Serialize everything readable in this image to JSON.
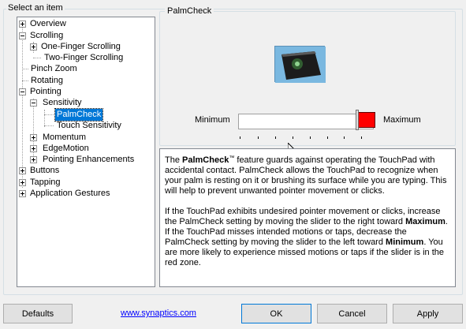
{
  "group_title": "Select an item",
  "tree": {
    "overview": "Overview",
    "scrolling": "Scrolling",
    "one_finger": "One-Finger Scrolling",
    "two_finger": "Two-Finger Scrolling",
    "pinch_zoom": "Pinch Zoom",
    "rotating": "Rotating",
    "pointing": "Pointing",
    "sensitivity": "Sensitivity",
    "palmcheck": "PalmCheck",
    "touch_sensitivity": "Touch Sensitivity",
    "momentum": "Momentum",
    "edgemotion": "EdgeMotion",
    "pointing_enhancements": "Pointing Enhancements",
    "buttons": "Buttons",
    "tapping": "Tapping",
    "app_gestures": "Application Gestures"
  },
  "panel": {
    "title": "PalmCheck",
    "min_label": "Minimum",
    "max_label": "Maximum",
    "slider_value_fraction": 0.87,
    "colors": {
      "red_zone": "#ff0000",
      "selection": "#0078d7"
    }
  },
  "description": {
    "p1_pre": "The ",
    "p1_bold": "PalmCheck",
    "p1_tm": "™",
    "p1_post": " feature guards against operating the TouchPad with accidental contact. PalmCheck allows the TouchPad to recognize when your palm is resting on it or brushing its surface while you are typing. This will help to prevent unwanted pointer movement or clicks.",
    "p2_a": "If the TouchPad exhibits undesired pointer movement or clicks, increase the PalmCheck setting by moving the slider to the right toward ",
    "p2_b": "Maximum",
    "p2_c": ". If the TouchPad misses intended motions or taps, decrease the PalmCheck setting by moving the slider to the left toward ",
    "p2_d": "Minimum",
    "p2_e": ". You are more likely to experience missed motions or taps if the slider is in the red zone."
  },
  "footer": {
    "defaults": "Defaults",
    "link": "www.synaptics.com",
    "ok": "OK",
    "cancel": "Cancel",
    "apply": "Apply"
  }
}
